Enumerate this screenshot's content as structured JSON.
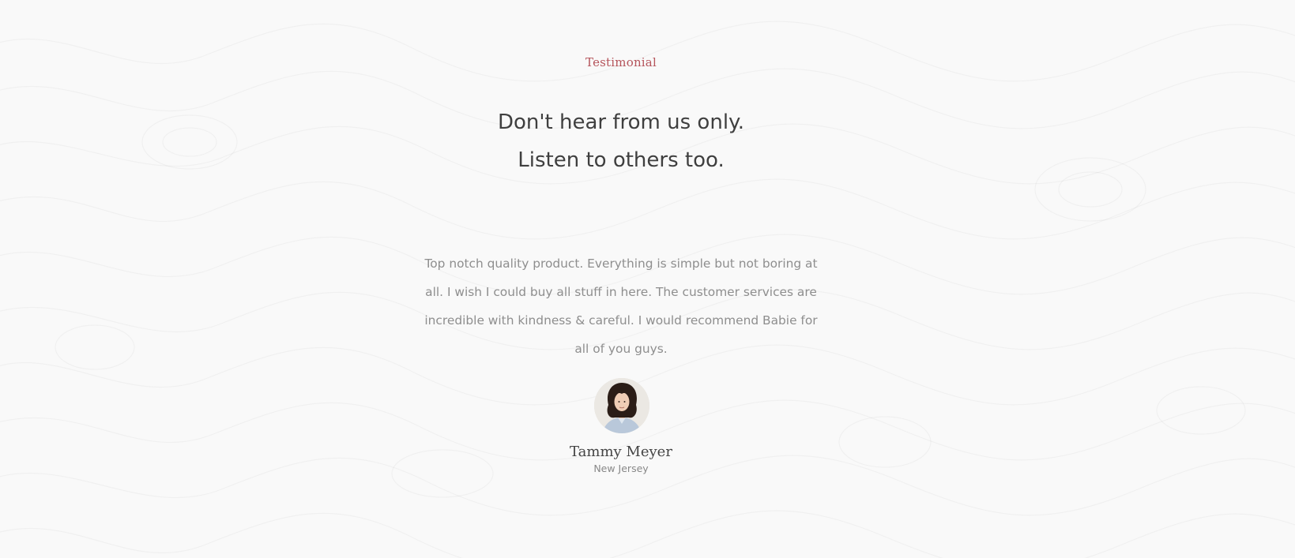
{
  "testimonial": {
    "eyebrow": "Testimonial",
    "heading_line1": "Don't hear from us only.",
    "heading_line2": "Listen to others too.",
    "quote": "Top notch quality product. Everything is simple but not boring at all. I wish I could buy all stuff in here. The customer services are incredible with kindness & careful. I would recommend Babie for all of you guys.",
    "author_name": "Tammy Meyer",
    "author_location": "New Jersey"
  },
  "colors": {
    "background": "#f9f9f9",
    "accent": "#b5545b",
    "heading": "#3f3f3f",
    "body_text": "#8e8e8e"
  },
  "icons": {
    "avatar": "author-avatar-photo"
  }
}
